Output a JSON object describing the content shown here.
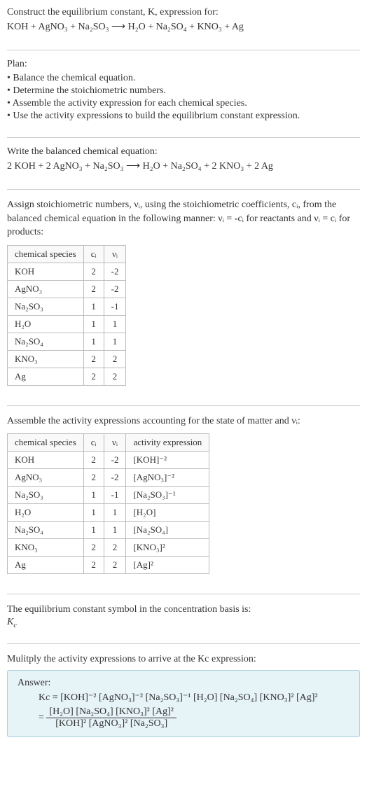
{
  "title": "Construct the equilibrium constant, K, expression for:",
  "main_equation": "KOH + AgNO₃ + Na₂SO₃ ⟶ H₂O + Na₂SO₄ + KNO₃ + Ag",
  "plan_label": "Plan:",
  "plan_items": [
    "• Balance the chemical equation.",
    "• Determine the stoichiometric numbers.",
    "• Assemble the activity expression for each chemical species.",
    "• Use the activity expressions to build the equilibrium constant expression."
  ],
  "balanced_label": "Write the balanced chemical equation:",
  "balanced_equation": "2 KOH + 2 AgNO₃ + Na₂SO₃ ⟶ H₂O + Na₂SO₄ + 2 KNO₃ + 2 Ag",
  "assign_text": "Assign stoichiometric numbers, νᵢ, using the stoichiometric coefficients, cᵢ, from the balanced chemical equation in the following manner: νᵢ = -cᵢ for reactants and νᵢ = cᵢ for products:",
  "table1": {
    "headers": [
      "chemical species",
      "cᵢ",
      "νᵢ"
    ],
    "rows": [
      [
        "KOH",
        "2",
        "-2"
      ],
      [
        "AgNO₃",
        "2",
        "-2"
      ],
      [
        "Na₂SO₃",
        "1",
        "-1"
      ],
      [
        "H₂O",
        "1",
        "1"
      ],
      [
        "Na₂SO₄",
        "1",
        "1"
      ],
      [
        "KNO₃",
        "2",
        "2"
      ],
      [
        "Ag",
        "2",
        "2"
      ]
    ]
  },
  "assemble_text": "Assemble the activity expressions accounting for the state of matter and νᵢ:",
  "table2": {
    "headers": [
      "chemical species",
      "cᵢ",
      "νᵢ",
      "activity expression"
    ],
    "rows": [
      [
        "KOH",
        "2",
        "-2",
        "[KOH]⁻²"
      ],
      [
        "AgNO₃",
        "2",
        "-2",
        "[AgNO₃]⁻²"
      ],
      [
        "Na₂SO₃",
        "1",
        "-1",
        "[Na₂SO₃]⁻¹"
      ],
      [
        "H₂O",
        "1",
        "1",
        "[H₂O]"
      ],
      [
        "Na₂SO₄",
        "1",
        "1",
        "[Na₂SO₄]"
      ],
      [
        "KNO₃",
        "2",
        "2",
        "[KNO₃]²"
      ],
      [
        "Ag",
        "2",
        "2",
        "[Ag]²"
      ]
    ]
  },
  "symbol_text": "The equilibrium constant symbol in the concentration basis is:",
  "symbol_italic": "K",
  "symbol_sub": "c",
  "multiply_text": "Mulitply the activity expressions to arrive at the Kc expression:",
  "answer_label": "Answer:",
  "answer_line1": "Kc = [KOH]⁻² [AgNO₃]⁻² [Na₂SO₃]⁻¹ [H₂O] [Na₂SO₄] [KNO₃]² [Ag]²",
  "answer_eq": "=",
  "answer_num": "[H₂O] [Na₂SO₄] [KNO₃]² [Ag]²",
  "answer_den": "[KOH]² [AgNO₃]² [Na₂SO₃]"
}
